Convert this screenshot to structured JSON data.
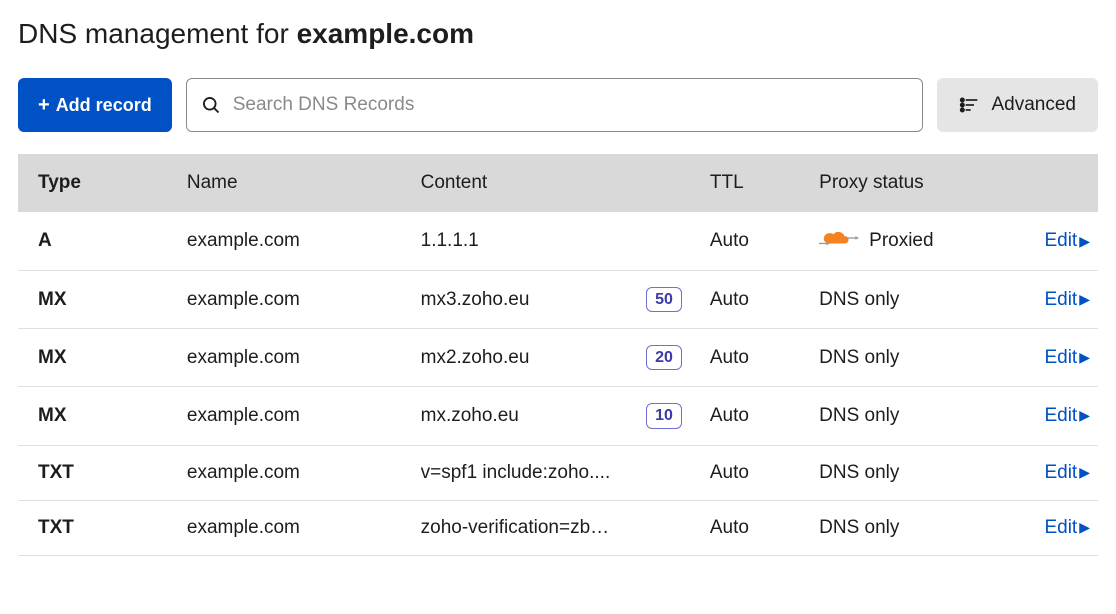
{
  "title_prefix": "DNS management for ",
  "title_domain": "example.com",
  "toolbar": {
    "add_label": "Add record",
    "search_placeholder": "Search DNS Records",
    "advanced_label": "Advanced"
  },
  "columns": {
    "type": "Type",
    "name": "Name",
    "content": "Content",
    "ttl": "TTL",
    "proxy": "Proxy status"
  },
  "edit_label": "Edit",
  "records": [
    {
      "type": "A",
      "name": "example.com",
      "content": "1.1.1.1",
      "priority": null,
      "ttl": "Auto",
      "proxy": "Proxied",
      "proxied_icon": true
    },
    {
      "type": "MX",
      "name": "example.com",
      "content": "mx3.zoho.eu",
      "priority": "50",
      "ttl": "Auto",
      "proxy": "DNS only",
      "proxied_icon": false
    },
    {
      "type": "MX",
      "name": "example.com",
      "content": "mx2.zoho.eu",
      "priority": "20",
      "ttl": "Auto",
      "proxy": "DNS only",
      "proxied_icon": false
    },
    {
      "type": "MX",
      "name": "example.com",
      "content": "mx.zoho.eu",
      "priority": "10",
      "ttl": "Auto",
      "proxy": "DNS only",
      "proxied_icon": false
    },
    {
      "type": "TXT",
      "name": "example.com",
      "content": "v=spf1 include:zoho....",
      "priority": null,
      "ttl": "Auto",
      "proxy": "DNS only",
      "proxied_icon": false
    },
    {
      "type": "TXT",
      "name": "example.com",
      "content": "zoho-verification=zb…",
      "priority": null,
      "ttl": "Auto",
      "proxy": "DNS only",
      "proxied_icon": false
    }
  ]
}
